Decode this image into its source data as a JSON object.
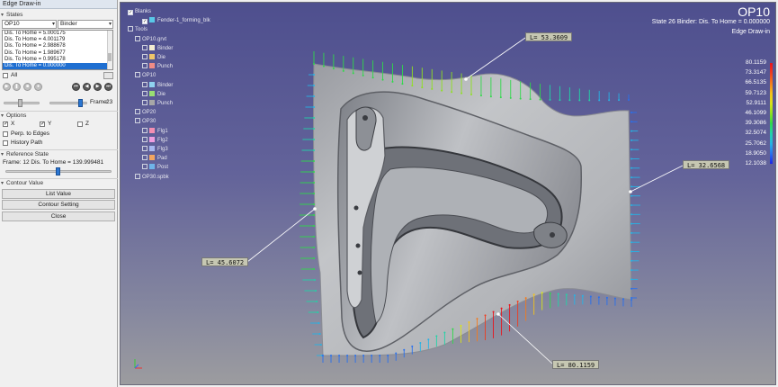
{
  "panel": {
    "title": "Edge Draw-in",
    "states_header": "States",
    "op_select": "OP10",
    "tool_select": "Binder",
    "state_list": [
      "Dis. To Home = 5.000175",
      "Dis. To Home = 4.001179",
      "Dis. To Home = 2.988678",
      "Dis. To Home = 1.989677",
      "Dis. To Home = 0.995178",
      "Dis. To Home = 0.000000"
    ],
    "state_selected_index": 5,
    "all_label": "All",
    "frame_label": "Frame:",
    "frame_value": "23",
    "frame_slider_fraction": 0.82,
    "options_header": "Options",
    "x_label": "X",
    "y_label": "Y",
    "z_label": "Z",
    "perp_label": "Perp. to Edges",
    "history_label": "History Path",
    "reference_header": "Reference State",
    "ref_frame_text": "Frame:  12  Dis. To Home = 139.999481",
    "ref_slider_fraction": 0.49,
    "contour_header": "Contour Value",
    "list_value_btn": "List Value",
    "contour_setting_btn": "Contour Setting",
    "close_btn": "Close"
  },
  "viewport": {
    "title": "OP10",
    "state_text": "State 26   Binder: Dis. To Home = 0.000000",
    "mode_text": "Edge Draw-in",
    "tree": [
      {
        "label": "Blanks",
        "indent": 0,
        "swatch": ""
      },
      {
        "label": "Fender-1_forming_blk",
        "indent": 2,
        "swatch": "#59c8e8"
      },
      {
        "label": "Tools",
        "indent": 0,
        "swatch": ""
      },
      {
        "label": "OP10.grvt",
        "indent": 1,
        "swatch": ""
      },
      {
        "label": "Binder",
        "indent": 2,
        "swatch": "#f3edd1"
      },
      {
        "label": "Die",
        "indent": 2,
        "swatch": "#eec66a"
      },
      {
        "label": "Punch",
        "indent": 2,
        "swatch": "#ef8b86"
      },
      {
        "label": "OP10",
        "indent": 1,
        "swatch": ""
      },
      {
        "label": "Binder",
        "indent": 2,
        "swatch": "#8fd2f0"
      },
      {
        "label": "Die",
        "indent": 2,
        "swatch": "#9adf73"
      },
      {
        "label": "Punch",
        "indent": 2,
        "swatch": "#a7a7a7"
      },
      {
        "label": "OP20",
        "indent": 1,
        "swatch": ""
      },
      {
        "label": "OP30",
        "indent": 1,
        "swatch": ""
      },
      {
        "label": "Flg1",
        "indent": 2,
        "swatch": "#f48fb3"
      },
      {
        "label": "Flg2",
        "indent": 2,
        "swatch": "#ee9ee0"
      },
      {
        "label": "Flg3",
        "indent": 2,
        "swatch": "#a7b8f0"
      },
      {
        "label": "Pad",
        "indent": 2,
        "swatch": "#f2a561"
      },
      {
        "label": "Post",
        "indent": 2,
        "swatch": "#6fb3e8"
      },
      {
        "label": "OP30.spbk",
        "indent": 1,
        "swatch": ""
      }
    ],
    "legend": [
      {
        "value": "80.1159",
        "color": "#e8141d"
      },
      {
        "value": "73.3147",
        "color": "#ef3d20"
      },
      {
        "value": "66.5135",
        "color": "#f47a1d"
      },
      {
        "value": "59.7123",
        "color": "#f4c31b"
      },
      {
        "value": "52.9111",
        "color": "#d8e419"
      },
      {
        "value": "46.1099",
        "color": "#8ee11f"
      },
      {
        "value": "39.3086",
        "color": "#2fd94a"
      },
      {
        "value": "32.5074",
        "color": "#21d3a7"
      },
      {
        "value": "25.7062",
        "color": "#25b3e6"
      },
      {
        "value": "18.9050",
        "color": "#2870ee"
      },
      {
        "value": "12.1038",
        "color": "#1b25e8"
      }
    ],
    "callouts": {
      "top": "L= 53.3609",
      "right": "L= 32.6568",
      "left": "L= 45.6072",
      "bottom": "L= 80.1159"
    }
  }
}
